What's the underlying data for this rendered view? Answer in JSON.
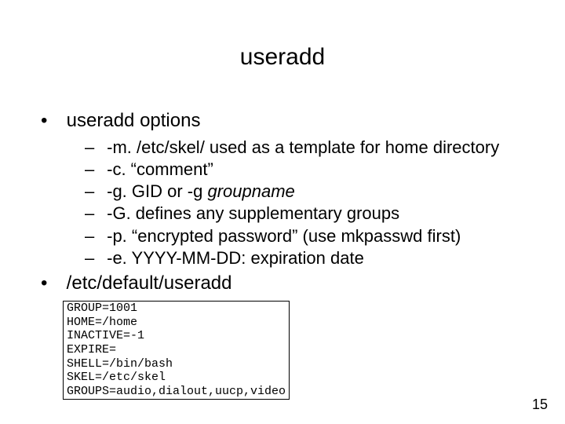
{
  "slide": {
    "title": "useradd",
    "page_number": "15",
    "bullets": [
      {
        "text": "useradd options"
      },
      {
        "text": "/etc/default/useradd"
      }
    ],
    "options": [
      {
        "prefix": "-m. /etc/skel/ used as a template for home directory"
      },
      {
        "prefix": "-c. “comment”"
      },
      {
        "prefix": "-g. GID or -g ",
        "italic": "groupname"
      },
      {
        "prefix": "-G. defines any supplementary groups"
      },
      {
        "prefix": "-p. “encrypted password” (use mkpasswd first)"
      },
      {
        "prefix": "-e. YYYY-MM-DD: expiration date"
      }
    ],
    "config": "GROUP=1001\nHOME=/home\nINACTIVE=-1\nEXPIRE=\nSHELL=/bin/bash\nSKEL=/etc/skel\nGROUPS=audio,dialout,uucp,video"
  }
}
